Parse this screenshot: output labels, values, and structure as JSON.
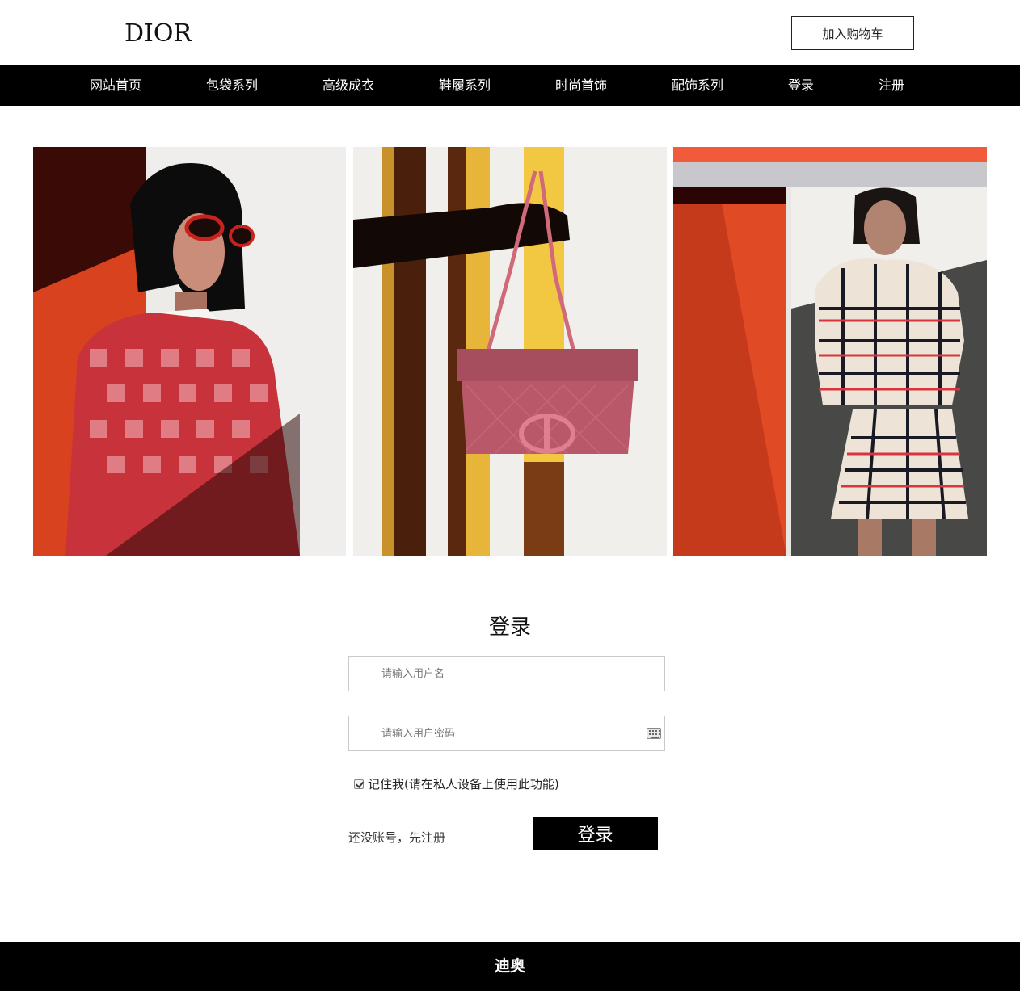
{
  "header": {
    "logo": "DIOR",
    "cart_label": "加入购物车"
  },
  "nav": {
    "items": [
      {
        "label": "网站首页"
      },
      {
        "label": "包袋系列"
      },
      {
        "label": "高级成衣"
      },
      {
        "label": "鞋履系列"
      },
      {
        "label": "时尚首饰"
      },
      {
        "label": "配饰系列"
      },
      {
        "label": "登录"
      },
      {
        "label": "注册"
      }
    ]
  },
  "gallery": {
    "images": [
      {
        "subject": "model in red gingham sweater and red sunglasses"
      },
      {
        "subject": "pink quilted handbag held against striped wall"
      },
      {
        "subject": "model in checked tweed jacket and skirt"
      }
    ]
  },
  "login": {
    "title": "登录",
    "username_placeholder": "请输入用户名",
    "password_placeholder": "请输入用户密码",
    "remember_label": "记住我(请在私人设备上使用此功能)",
    "remember_checked": true,
    "register_link": "还没账号，先注册",
    "submit_label": "登录"
  },
  "footer": {
    "text": "迪奥"
  },
  "colors": {
    "nav_bg": "#000000",
    "footer_bg": "#000000",
    "button_bg": "#000000",
    "text": "#111111"
  }
}
